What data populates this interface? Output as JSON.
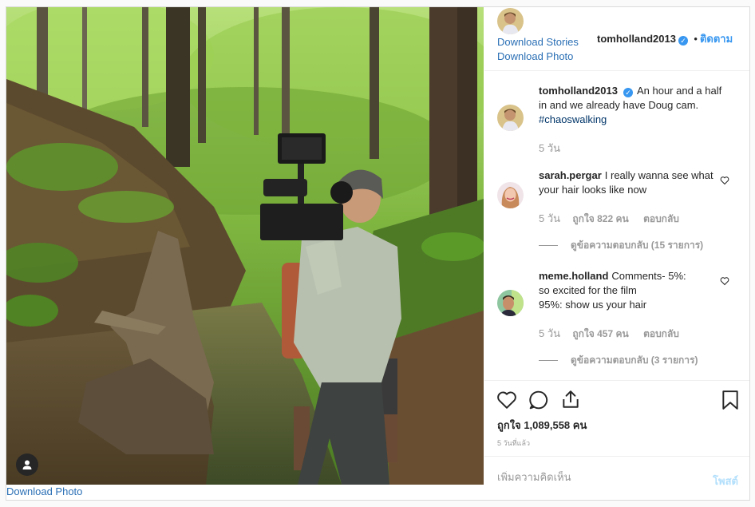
{
  "photo": {
    "download_label": "Download Photo",
    "user_tag_icon": "user-icon"
  },
  "header": {
    "username": "tomholland2013",
    "follow_label": "ติดตาม",
    "download_stories": "Download Stories",
    "download_photo": "Download Photo"
  },
  "caption": {
    "username": "tomholland2013",
    "text": "An hour and a half in and we already have Doug cam.",
    "hashtag": "#chaoswalking",
    "time": "5 วัน"
  },
  "comments": [
    {
      "username": "sarah.pergar",
      "text": "I really wanna see what your hair looks like now",
      "time": "5 วัน",
      "likes": "ถูกใจ 822 คน",
      "reply": "ตอบกลับ",
      "view_replies": "ดูข้อความตอบกลับ (15 รายการ)"
    },
    {
      "username": "meme.holland",
      "text_line1": "Comments- 5%:",
      "text_line2": "so excited for the film",
      "text_line3": "95%: show us your hair",
      "time": "5 วัน",
      "likes": "ถูกใจ 457 คน",
      "reply": "ตอบกลับ",
      "view_replies": "ดูข้อความตอบกลับ (3 รายการ)"
    }
  ],
  "actions": {
    "likes": "ถูกใจ 1,089,558 คน",
    "time_ago": "5 วันที่แล้ว"
  },
  "comment_box": {
    "placeholder": "เพิ่มความคิดเห็น",
    "post_label": "โพสต์"
  },
  "colors": {
    "accent": "#3897f0",
    "link": "#2a6fb5",
    "muted": "#999999"
  }
}
